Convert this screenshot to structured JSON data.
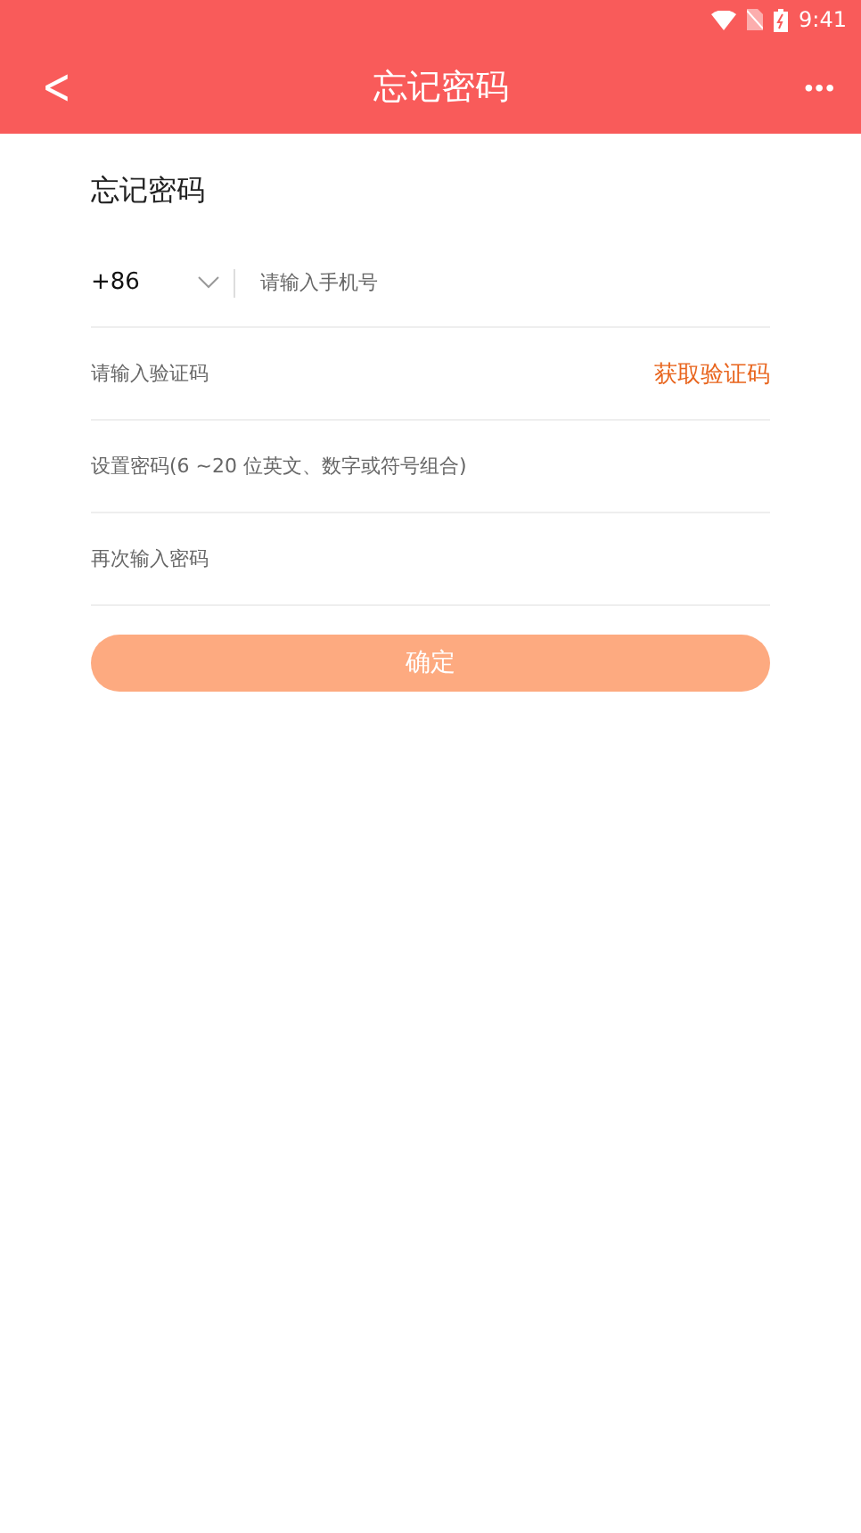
{
  "status_bar": {
    "time": "9:41"
  },
  "header": {
    "back": "<",
    "title": "忘记密码",
    "more": "•••"
  },
  "form": {
    "heading": "忘记密码",
    "country_code": "+86",
    "phone": {
      "placeholder": "请输入手机号"
    },
    "code": {
      "placeholder": "请输入验证码"
    },
    "get_code": "获取验证码",
    "password": {
      "placeholder": "设置密码(6 ~20 位英文、数字或符号组合)"
    },
    "confirm_password": {
      "placeholder": "再次输入密码"
    },
    "submit": {
      "label": "确定",
      "disabled": true
    }
  }
}
